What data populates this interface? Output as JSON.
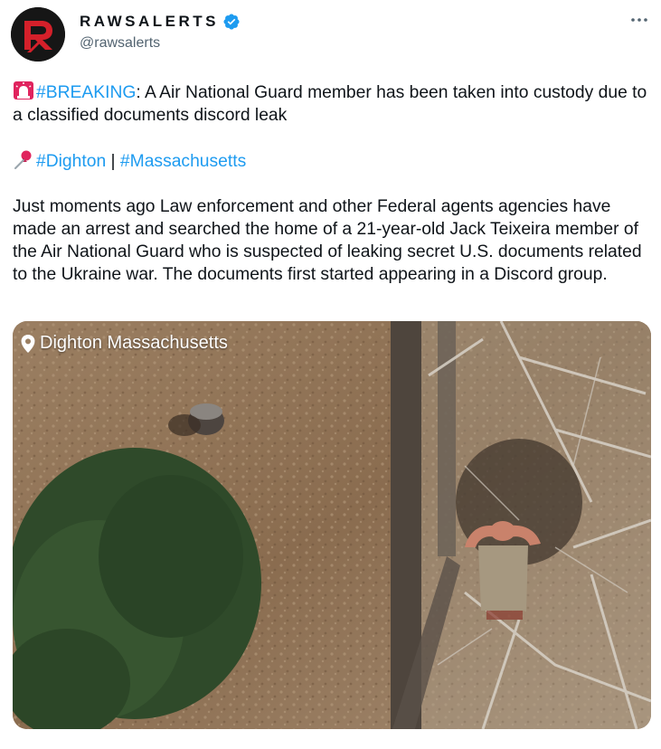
{
  "author": {
    "display_name": "RAWSALERTS",
    "handle": "@rawsalerts",
    "avatar_icon": "raws-logo-icon",
    "verified_icon": "verified-badge-icon"
  },
  "more_icon": "more-options-icon",
  "tweet": {
    "line1_hashtag": "#BREAKING",
    "line1_rest": ": A Air National Guard member has been taken into custody due to a classified documents discord leak",
    "line2_hashtag1": "#Dighton",
    "line2_sep": " | ",
    "line2_hashtag2": "#Massachusetts",
    "body": "Just moments ago Law enforcement and other Federal agents agencies have made an arrest and searched the home of a 21-year-old Jack Teixeira member of the Air National Guard who is suspected of leaking secret U.S. documents related to the Ukraine war. The documents first started appearing in a Discord group."
  },
  "media": {
    "location_label": "Dighton Massachusetts",
    "location_icon": "location-pin-icon"
  },
  "colors": {
    "hashtag": "#1d9bf0",
    "handle": "#536471",
    "verified": "#1d9bf0",
    "text": "#0f1419"
  }
}
